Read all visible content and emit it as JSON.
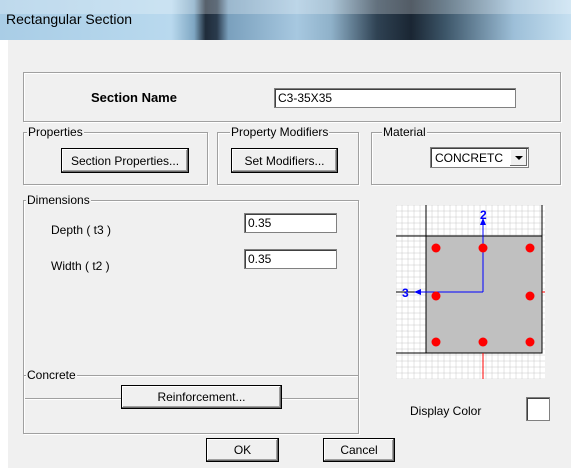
{
  "window": {
    "title": "Rectangular Section"
  },
  "section_name": {
    "label": "Section Name",
    "value": "C3-35X35"
  },
  "properties": {
    "group_label": "Properties",
    "button_label": "Section Properties..."
  },
  "property_modifiers": {
    "group_label": "Property Modifiers",
    "button_label": "Set Modifiers..."
  },
  "material": {
    "group_label": "Material",
    "selected": "CONCRETC"
  },
  "dimensions": {
    "group_label": "Dimensions",
    "depth": {
      "label": "Depth  ( t3 )",
      "value": "0.35"
    },
    "width": {
      "label": "Width  ( t2 )",
      "value": "0.35"
    }
  },
  "preview": {
    "axis2_label": "2",
    "axis3_label": "3",
    "rebar_count": 8,
    "colors": {
      "section_fill": "#c0c0c0",
      "rebar": "#ff0000",
      "axis": "#0000ff",
      "grid": "#c8c8c8"
    }
  },
  "concrete": {
    "group_label": "Concrete",
    "button_label": "Reinforcement..."
  },
  "display_color": {
    "label": "Display Color",
    "color": "#ffffff"
  },
  "footer": {
    "ok_label": "OK",
    "cancel_label": "Cancel"
  }
}
